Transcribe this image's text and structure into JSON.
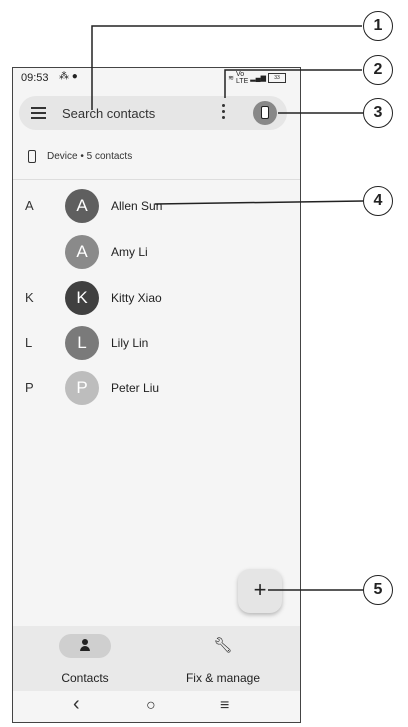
{
  "status_bar": {
    "time": "09:53",
    "battery": "33"
  },
  "search": {
    "placeholder": "Search contacts"
  },
  "account": {
    "label": "Device • 5 contacts"
  },
  "contacts": [
    {
      "letter": "A",
      "initial": "A",
      "name": "Allen Sun",
      "color": "#5f5f5f"
    },
    {
      "letter": "",
      "initial": "A",
      "name": "Amy Li",
      "color": "#8a8a8a"
    },
    {
      "letter": "K",
      "initial": "K",
      "name": "Kitty Xiao",
      "color": "#404040"
    },
    {
      "letter": "L",
      "initial": "L",
      "name": "Lily Lin",
      "color": "#7a7a7a"
    },
    {
      "letter": "P",
      "initial": "P",
      "name": "Peter Liu",
      "color": "#bdbdbd"
    }
  ],
  "fab": {
    "icon": "+"
  },
  "bottom_nav": {
    "contacts": "Contacts",
    "fix_manage": "Fix & manage"
  },
  "sys_nav": {
    "back": "‹",
    "home": "○",
    "recents": "≡"
  },
  "callouts": [
    "1",
    "2",
    "3",
    "4",
    "5"
  ]
}
